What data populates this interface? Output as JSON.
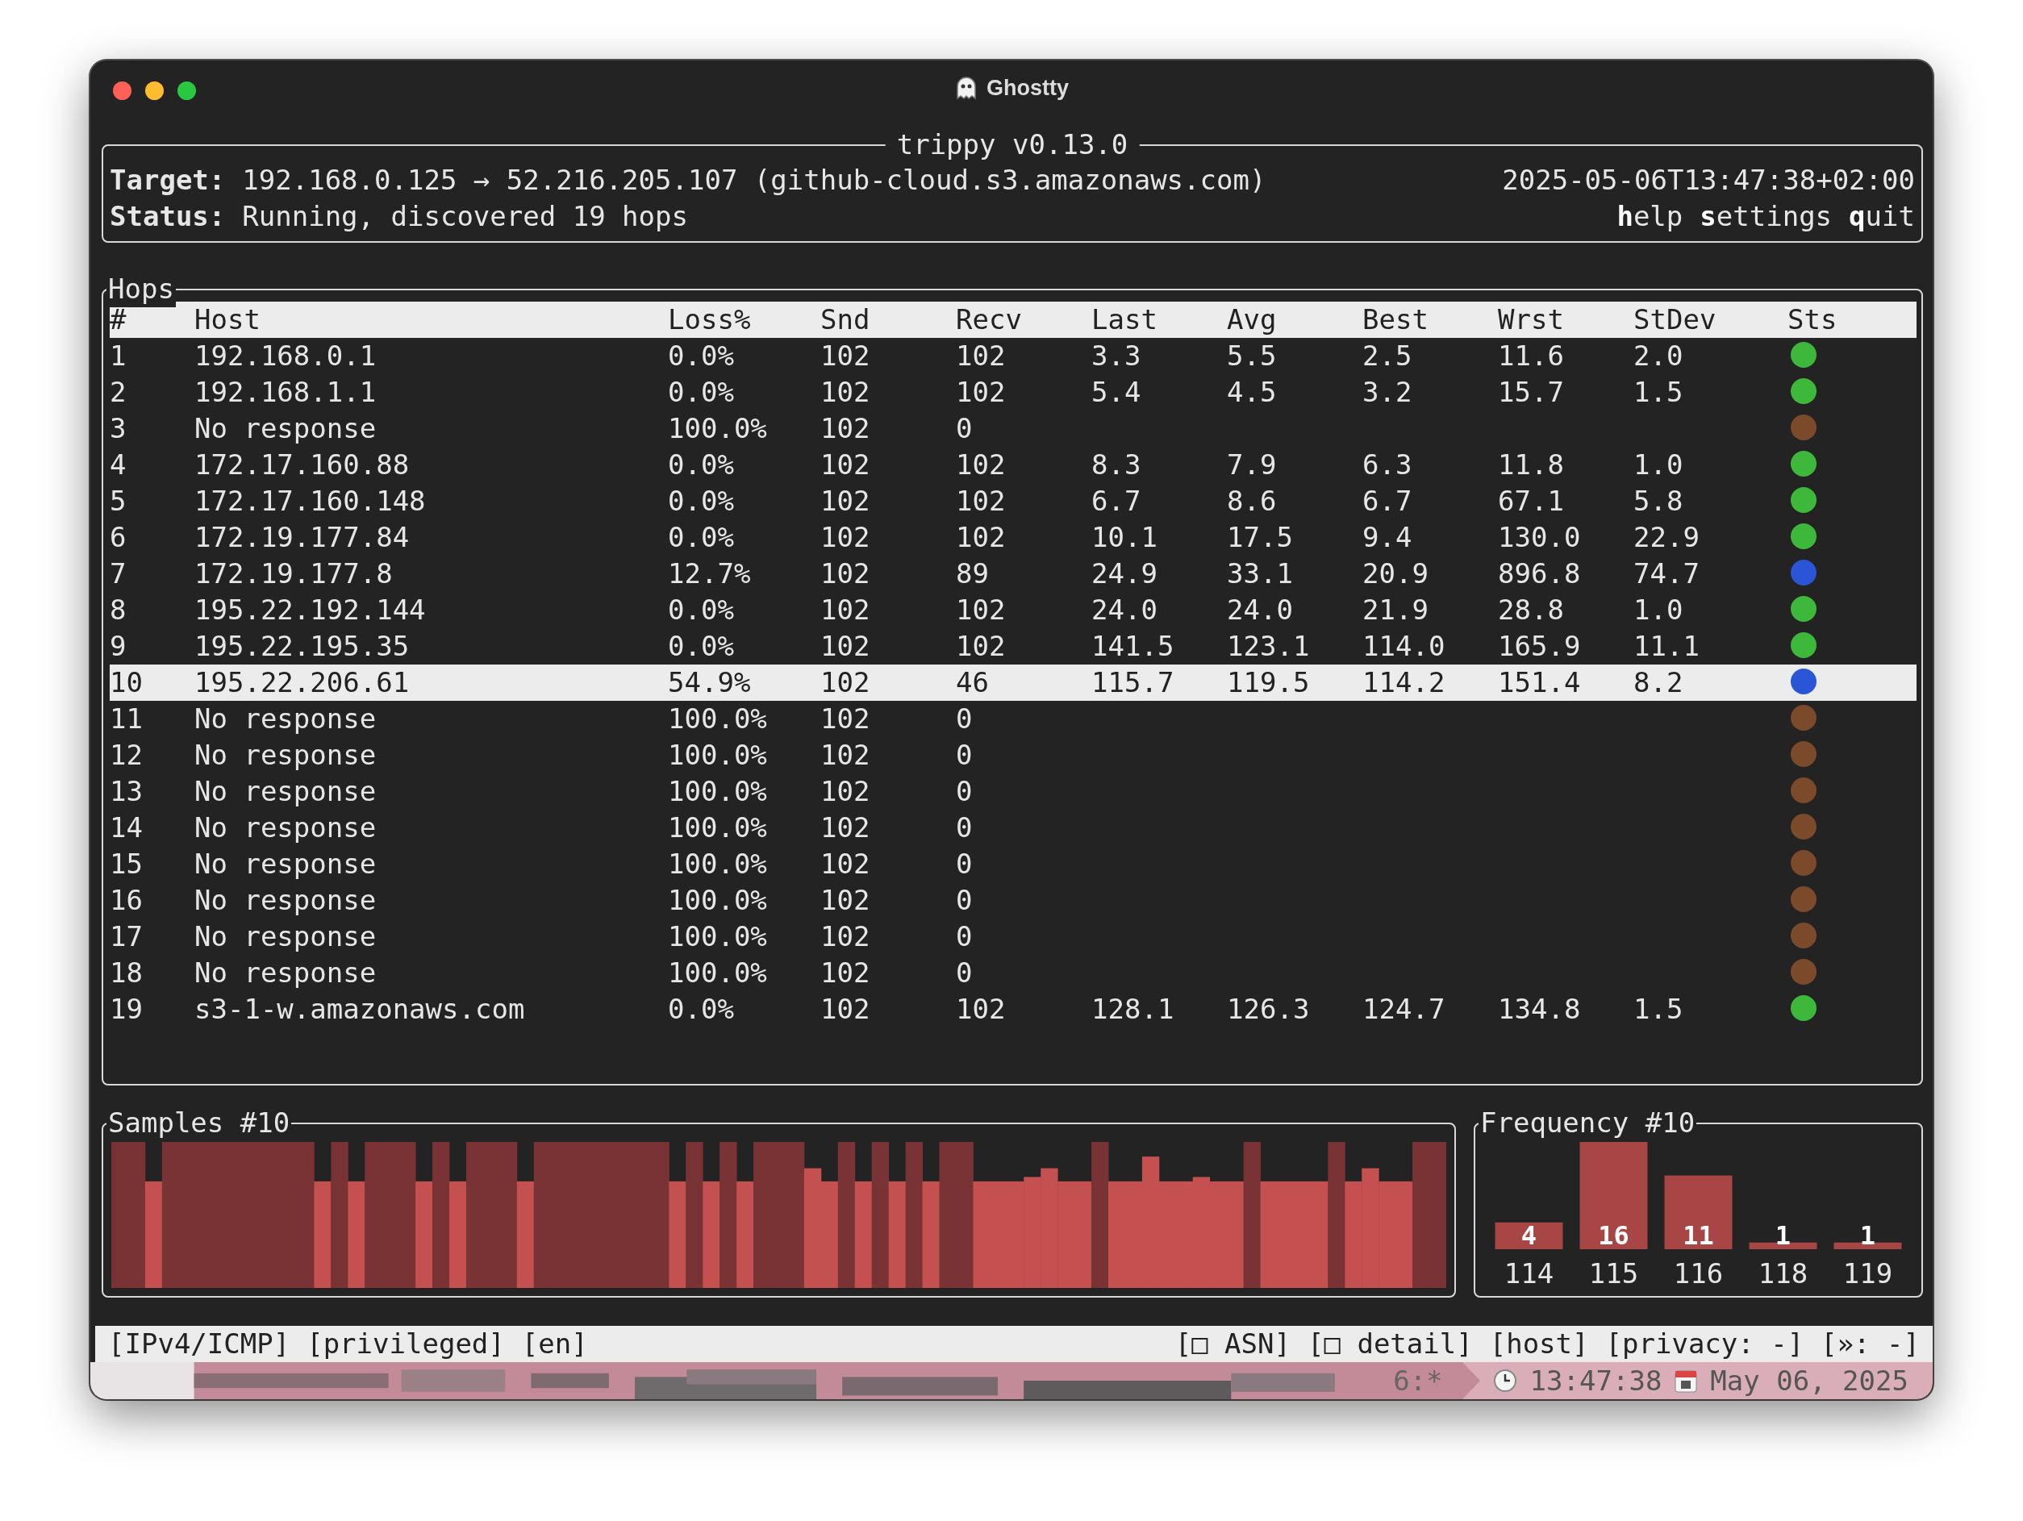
{
  "window": {
    "title": "Ghostty"
  },
  "header": {
    "title": "trippy v0.13.0",
    "target_label": "Target:",
    "target": "192.168.0.125 → 52.216.205.107 (github-cloud.s3.amazonaws.com)",
    "timestamp": "2025-05-06T13:47:38+02:00",
    "status_label": "Status:",
    "status": "Running, discovered 19 hops",
    "menu": [
      "**h**elp",
      "**s**ettings",
      "**q**uit"
    ]
  },
  "hops": {
    "title": "Hops",
    "columns": [
      "#",
      "Host",
      "Loss%",
      "Snd",
      "Recv",
      "Last",
      "Avg",
      "Best",
      "Wrst",
      "StDev",
      "Sts"
    ],
    "rows": [
      {
        "cells": [
          "1",
          "192.168.0.1",
          "0.0%",
          "102",
          "102",
          "3.3",
          "5.5",
          "2.5",
          "11.6",
          "2.0"
        ],
        "color": "#3db83a",
        "selected": false
      },
      {
        "cells": [
          "2",
          "192.168.1.1",
          "0.0%",
          "102",
          "102",
          "5.4",
          "4.5",
          "3.2",
          "15.7",
          "1.5"
        ],
        "color": "#3db83a",
        "selected": false
      },
      {
        "cells": [
          "3",
          "No response",
          "100.0%",
          "102",
          "0"
        ],
        "color": "#7a4a2a",
        "selected": false
      },
      {
        "cells": [
          "4",
          "172.17.160.88",
          "0.0%",
          "102",
          "102",
          "8.3",
          "7.9",
          "6.3",
          "11.8",
          "1.0"
        ],
        "color": "#3db83a",
        "selected": false
      },
      {
        "cells": [
          "5",
          "172.17.160.148",
          "0.0%",
          "102",
          "102",
          "6.7",
          "8.6",
          "6.7",
          "67.1",
          "5.8"
        ],
        "color": "#3db83a",
        "selected": false
      },
      {
        "cells": [
          "6",
          "172.19.177.84",
          "0.0%",
          "102",
          "102",
          "10.1",
          "17.5",
          "9.4",
          "130.0",
          "22.9"
        ],
        "color": "#3db83a",
        "selected": false
      },
      {
        "cells": [
          "7",
          "172.19.177.8",
          "12.7%",
          "102",
          "89",
          "24.9",
          "33.1",
          "20.9",
          "896.8",
          "74.7"
        ],
        "color": "#2a55d6",
        "selected": false
      },
      {
        "cells": [
          "8",
          "195.22.192.144",
          "0.0%",
          "102",
          "102",
          "24.0",
          "24.0",
          "21.9",
          "28.8",
          "1.0"
        ],
        "color": "#3db83a",
        "selected": false
      },
      {
        "cells": [
          "9",
          "195.22.195.35",
          "0.0%",
          "102",
          "102",
          "141.5",
          "123.1",
          "114.0",
          "165.9",
          "11.1"
        ],
        "color": "#3db83a",
        "selected": false
      },
      {
        "cells": [
          "10",
          "195.22.206.61",
          "54.9%",
          "102",
          "46",
          "115.7",
          "119.5",
          "114.2",
          "151.4",
          "8.2"
        ],
        "color": "#2a55d6",
        "selected": true
      },
      {
        "cells": [
          "11",
          "No response",
          "100.0%",
          "102",
          "0"
        ],
        "color": "#7a4a2a",
        "selected": false
      },
      {
        "cells": [
          "12",
          "No response",
          "100.0%",
          "102",
          "0"
        ],
        "color": "#7a4a2a",
        "selected": false
      },
      {
        "cells": [
          "13",
          "No response",
          "100.0%",
          "102",
          "0"
        ],
        "color": "#7a4a2a",
        "selected": false
      },
      {
        "cells": [
          "14",
          "No response",
          "100.0%",
          "102",
          "0"
        ],
        "color": "#7a4a2a",
        "selected": false
      },
      {
        "cells": [
          "15",
          "No response",
          "100.0%",
          "102",
          "0"
        ],
        "color": "#7a4a2a",
        "selected": false
      },
      {
        "cells": [
          "16",
          "No response",
          "100.0%",
          "102",
          "0"
        ],
        "color": "#7a4a2a",
        "selected": false
      },
      {
        "cells": [
          "17",
          "No response",
          "100.0%",
          "102",
          "0"
        ],
        "color": "#7a4a2a",
        "selected": false
      },
      {
        "cells": [
          "18",
          "No response",
          "100.0%",
          "102",
          "0"
        ],
        "color": "#7a4a2a",
        "selected": false
      },
      {
        "cells": [
          "19",
          "s3-1-w.amazonaws.com",
          "0.0%",
          "102",
          "102",
          "128.1",
          "126.3",
          "124.7",
          "134.8",
          "1.5"
        ],
        "color": "#3db83a",
        "selected": false
      }
    ]
  },
  "samples": {
    "title": "Samples #10"
  },
  "frequency": {
    "title": "Frequency #10",
    "chart_data": {
      "type": "bar",
      "categories": [
        "114",
        "115",
        "116",
        "118",
        "119"
      ],
      "values": [
        4,
        16,
        11,
        1,
        1
      ],
      "data_labels": true
    }
  },
  "status_line": {
    "left": [
      "[IPv4/ICMP]",
      "[privileged]",
      "[en]"
    ],
    "right": [
      "[□ ASN]",
      "[□ detail]",
      "[host]",
      "[privacy: -]",
      "[»: -]"
    ]
  },
  "tmux": {
    "window": "6:*",
    "time": "13:47:38",
    "date": "May 06, 2025"
  }
}
